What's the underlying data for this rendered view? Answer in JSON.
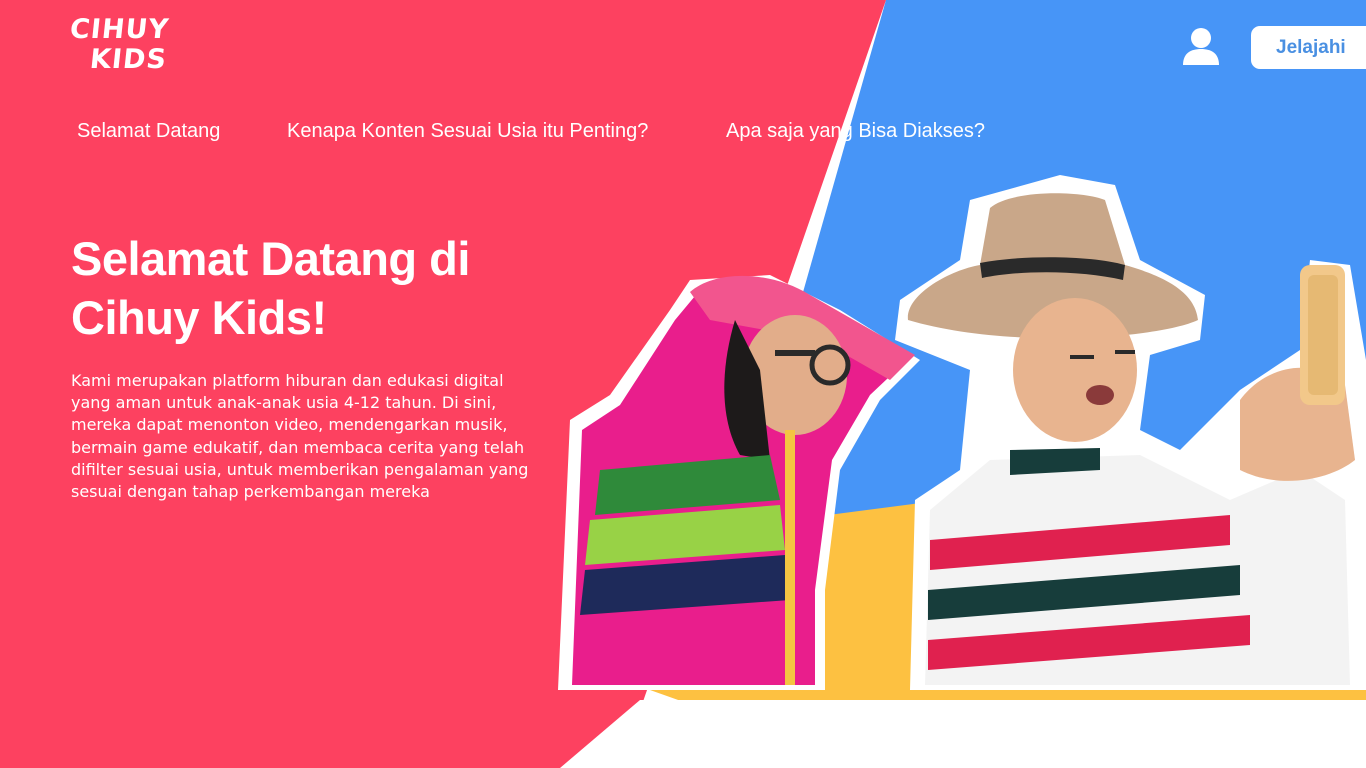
{
  "brand": {
    "logo_line1": "CIHUY",
    "logo_line2": "KIDS"
  },
  "nav": {
    "items": [
      {
        "label": "Selamat Datang"
      },
      {
        "label": "Kenapa Konten Sesuai Usia itu Penting?"
      },
      {
        "label": "Apa saja yang Bisa Diakses?"
      }
    ]
  },
  "header": {
    "user_icon": "user-icon",
    "cta_label": "Jelajahi"
  },
  "hero": {
    "title_line1": "Selamat Datang di",
    "title_line2": "Cihuy Kids!",
    "description": "Kami merupakan platform hiburan dan edukasi digital yang aman untuk anak-anak usia 4-12 tahun. Di sini, mereka dapat menonton video, mendengarkan musik, bermain game edukatif, dan membaca cerita yang telah difilter sesuai usia, untuk memberikan pengalaman yang sesuai dengan tahap perkembangan mereka"
  },
  "colors": {
    "red": "#fd4160",
    "blue": "#4795f7",
    "yellow": "#fdc141",
    "white": "#ffffff",
    "cta_text": "#4a90e2"
  }
}
